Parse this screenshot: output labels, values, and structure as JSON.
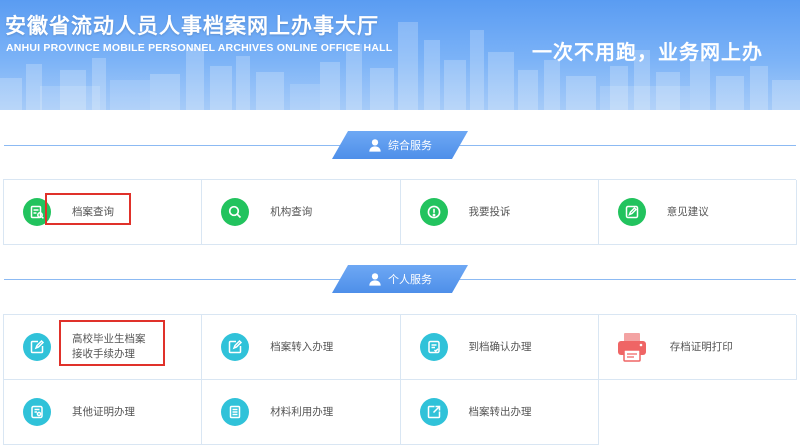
{
  "banner": {
    "title": "安徽省流动人员人事档案网上办事大厅",
    "subtitle": "ANHUI PROVINCE MOBILE PERSONNEL ARCHIVES ONLINE OFFICE HALL",
    "slogan": "一次不用跑，业务网上办"
  },
  "sections": [
    {
      "title": "综合服务",
      "icon": "person-icon",
      "items": [
        {
          "label": "档案查询",
          "icon": "archive-search-icon",
          "color": "#22c35e",
          "highlighted": true
        },
        {
          "label": "机构查询",
          "icon": "search-icon",
          "color": "#22c35e"
        },
        {
          "label": "我要投诉",
          "icon": "alert-icon",
          "color": "#22c35e"
        },
        {
          "label": "意见建议",
          "icon": "edit-icon",
          "color": "#22c35e"
        }
      ]
    },
    {
      "title": "个人服务",
      "icon": "person-icon",
      "items": [
        {
          "label": "高校毕业生档案\n接收手续办理",
          "icon": "edit-box-icon",
          "color": "#30c2d9",
          "highlighted": true
        },
        {
          "label": "档案转入办理",
          "icon": "edit-box-icon",
          "color": "#30c2d9"
        },
        {
          "label": "到档确认办理",
          "icon": "document-check-icon",
          "color": "#30c2d9"
        },
        {
          "label": "存档证明打印",
          "icon": "printer-icon",
          "color": "#f06a6a"
        },
        {
          "label": "其他证明办理",
          "icon": "certificate-icon",
          "color": "#30c2d9"
        },
        {
          "label": "材料利用办理",
          "icon": "document-icon",
          "color": "#30c2d9"
        },
        {
          "label": "档案转出办理",
          "icon": "export-icon",
          "color": "#30c2d9"
        }
      ]
    }
  ]
}
